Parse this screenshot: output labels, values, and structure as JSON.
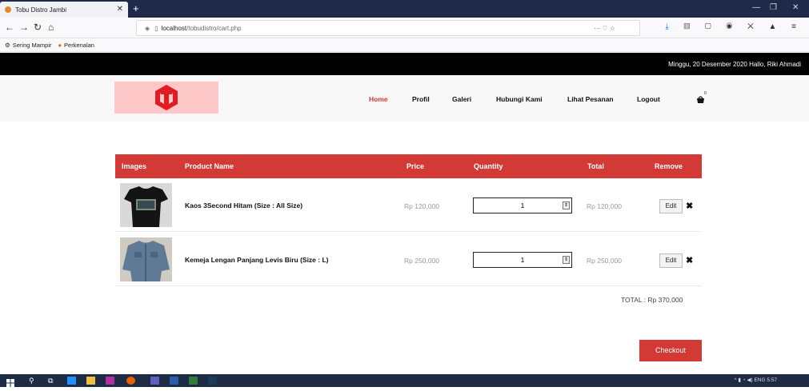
{
  "browser": {
    "tab_title": "Tobu Distro Jambi",
    "url_host": "localhost",
    "url_path": "/tobudistro/cart.php",
    "bookmarks": [
      "Sering Mampir",
      "Perkenalan"
    ]
  },
  "site": {
    "date_greeting": "Minggu, 20 Desember 2020   Hallo, Riki Ahmadi",
    "nav": [
      "Home",
      "Profil",
      "Galeri",
      "Hubungi Kami",
      "Lihat Pesanan",
      "Logout"
    ],
    "cart_count": "0"
  },
  "table": {
    "headers": [
      "Images",
      "Product Name",
      "Price",
      "Quantity",
      "Total",
      "Remove"
    ],
    "rows": [
      {
        "name": "Kaos 3Second Hitam (Size : All Size)",
        "price": "Rp 120,000",
        "qty": "1",
        "total": "Rp 120,000",
        "edit": "Edit",
        "remove": "✖"
      },
      {
        "name": "Kemeja Lengan Panjang Levis Biru (Size : L)",
        "price": "Rp 250,000",
        "qty": "1",
        "total": "Rp 250,000",
        "edit": "Edit",
        "remove": "✖"
      }
    ]
  },
  "summary": {
    "grand_total": "TOTAL : Rp 370,000",
    "checkout_label": "Checkout"
  },
  "taskbar": {
    "lang": "ENG",
    "time": "5:57"
  },
  "colors": {
    "accent": "#d33a35",
    "topbar": "#000000"
  }
}
